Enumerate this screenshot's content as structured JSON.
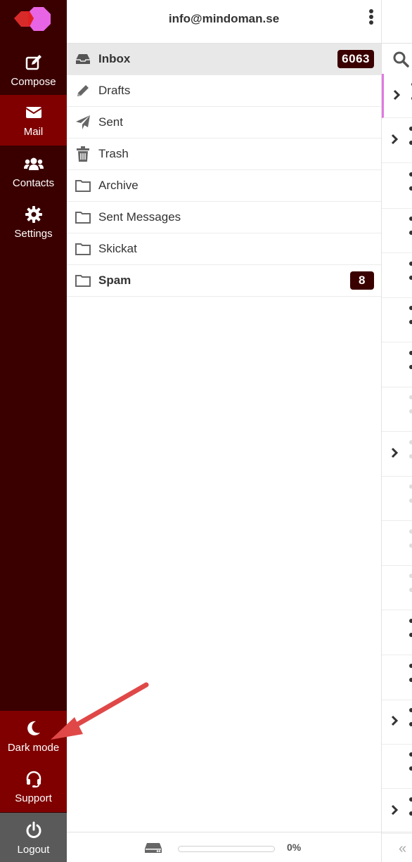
{
  "account": {
    "email": "info@mindoman.se"
  },
  "nav": {
    "compose": "Compose",
    "mail": "Mail",
    "contacts": "Contacts",
    "settings": "Settings",
    "dark_mode": "Dark mode",
    "support": "Support",
    "logout": "Logout"
  },
  "folders": [
    {
      "name": "Inbox",
      "icon": "inbox-icon",
      "unread": "6063",
      "selected": true,
      "bold": true
    },
    {
      "name": "Drafts",
      "icon": "pencil-icon"
    },
    {
      "name": "Sent",
      "icon": "paper-plane-icon"
    },
    {
      "name": "Trash",
      "icon": "trash-icon"
    },
    {
      "name": "Archive",
      "icon": "folder-icon"
    },
    {
      "name": "Sent Messages",
      "icon": "folder-icon"
    },
    {
      "name": "Skickat",
      "icon": "folder-icon"
    },
    {
      "name": "Spam",
      "icon": "folder-icon",
      "unread": "8",
      "bold": true
    }
  ],
  "quota": {
    "percent_label": "0%",
    "used_fraction": 0.0
  },
  "colors": {
    "sidebar": "#3a0000",
    "active": "#800000",
    "badge": "#3a0000",
    "selected_row": "#e8e8e8",
    "arrow": "#e04848"
  }
}
